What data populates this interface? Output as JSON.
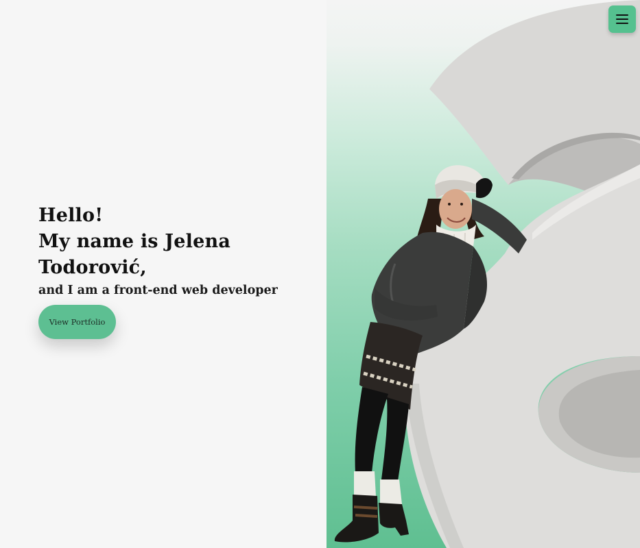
{
  "hero": {
    "greeting_line1": "Hello!",
    "greeting_line2": "My name is Jelena",
    "greeting_line3": "Todorović,",
    "tagline": "and I am a front-end web developer",
    "cta_label": "View Portfolio"
  },
  "nav": {
    "menu_icon": "hamburger-menu-icon"
  },
  "colors": {
    "accent": "#5dbf92",
    "background": "#f6f6f6",
    "text": "#111111"
  }
}
